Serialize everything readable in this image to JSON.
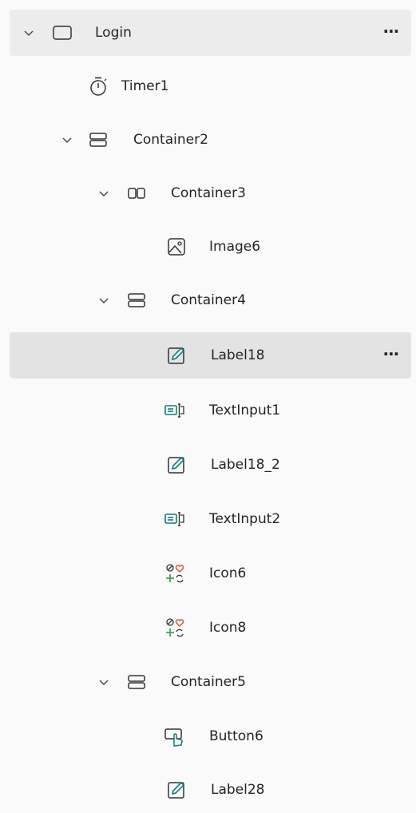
{
  "tree": {
    "items": [
      {
        "label": "Login",
        "icon": "screen-icon",
        "expanded": true,
        "more": "⋯"
      },
      {
        "label": "Timer1",
        "icon": "timer-icon"
      },
      {
        "label": "Container2",
        "icon": "vertical-container-icon",
        "expanded": true
      },
      {
        "label": "Container3",
        "icon": "horizontal-container-icon",
        "expanded": true
      },
      {
        "label": "Image6",
        "icon": "image-icon"
      },
      {
        "label": "Container4",
        "icon": "vertical-container-icon",
        "expanded": true
      },
      {
        "label": "Label18",
        "icon": "label-edit-icon",
        "selected": true,
        "more": "⋯"
      },
      {
        "label": "TextInput1",
        "icon": "text-input-icon"
      },
      {
        "label": "Label18_2",
        "icon": "label-edit-icon"
      },
      {
        "label": "TextInput2",
        "icon": "text-input-icon"
      },
      {
        "label": "Icon6",
        "icon": "icons-control-icon"
      },
      {
        "label": "Icon8",
        "icon": "icons-control-icon"
      },
      {
        "label": "Container5",
        "icon": "vertical-container-icon",
        "expanded": true
      },
      {
        "label": "Button6",
        "icon": "button-icon"
      },
      {
        "label": "Label28",
        "icon": "label-edit-icon"
      }
    ]
  },
  "colors": {
    "accent": "#0f7c78",
    "heart": "#e0533a",
    "plus": "#2f9e44",
    "selected_bg": "#e3e3e3"
  }
}
